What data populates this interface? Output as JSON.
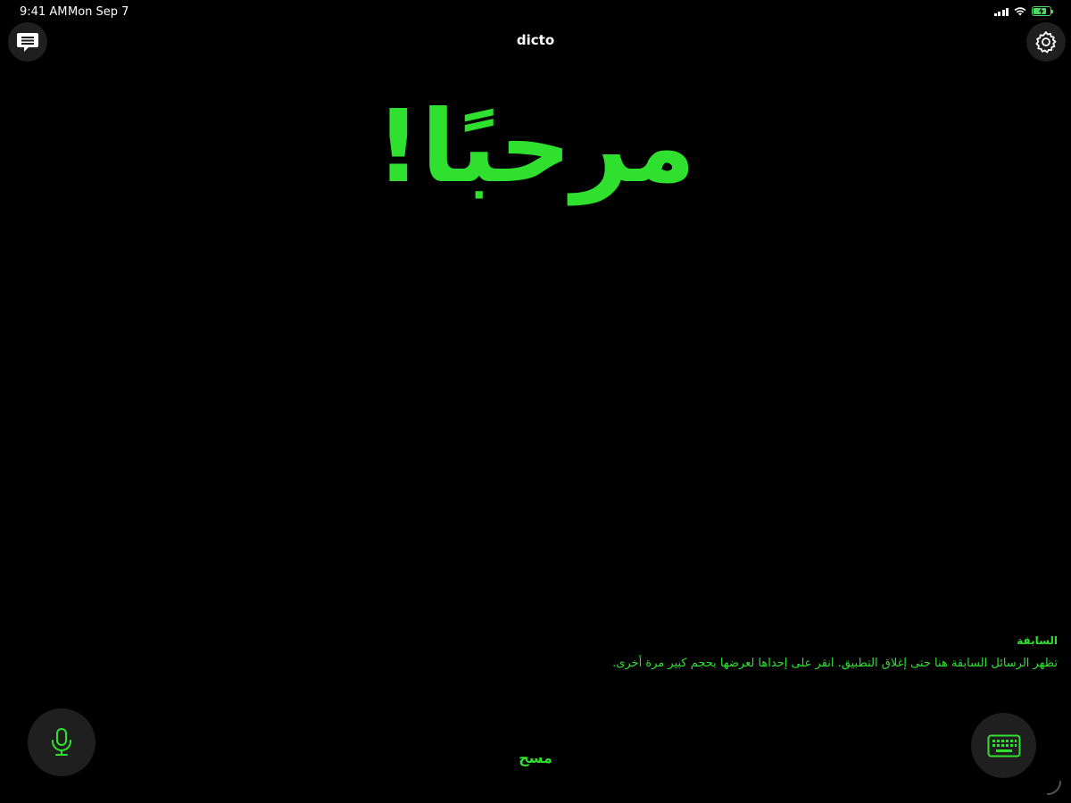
{
  "status_bar": {
    "time": "9:41 AM",
    "date": "Mon Sep 7",
    "battery_level": 0.8,
    "battery_charging": true
  },
  "header": {
    "title": "dicto",
    "left_icon": "message-list-icon",
    "right_icon": "gear-icon"
  },
  "main": {
    "message": "مرحبًا!"
  },
  "history": {
    "heading": "السابقة",
    "description": "تظهر الرسائل السابقة هنا حتى إغلاق التطبيق. انقر على إحداها لعرضها بحجم كبير مرة أخرى."
  },
  "bottom_bar": {
    "mic_icon": "microphone-icon",
    "clear_label": "مسح",
    "keyboard_icon": "keyboard-icon"
  },
  "colors": {
    "accent": "#2fe02f",
    "background": "#000000",
    "button_background": "#1f1f1f",
    "battery": "#4cd964"
  }
}
